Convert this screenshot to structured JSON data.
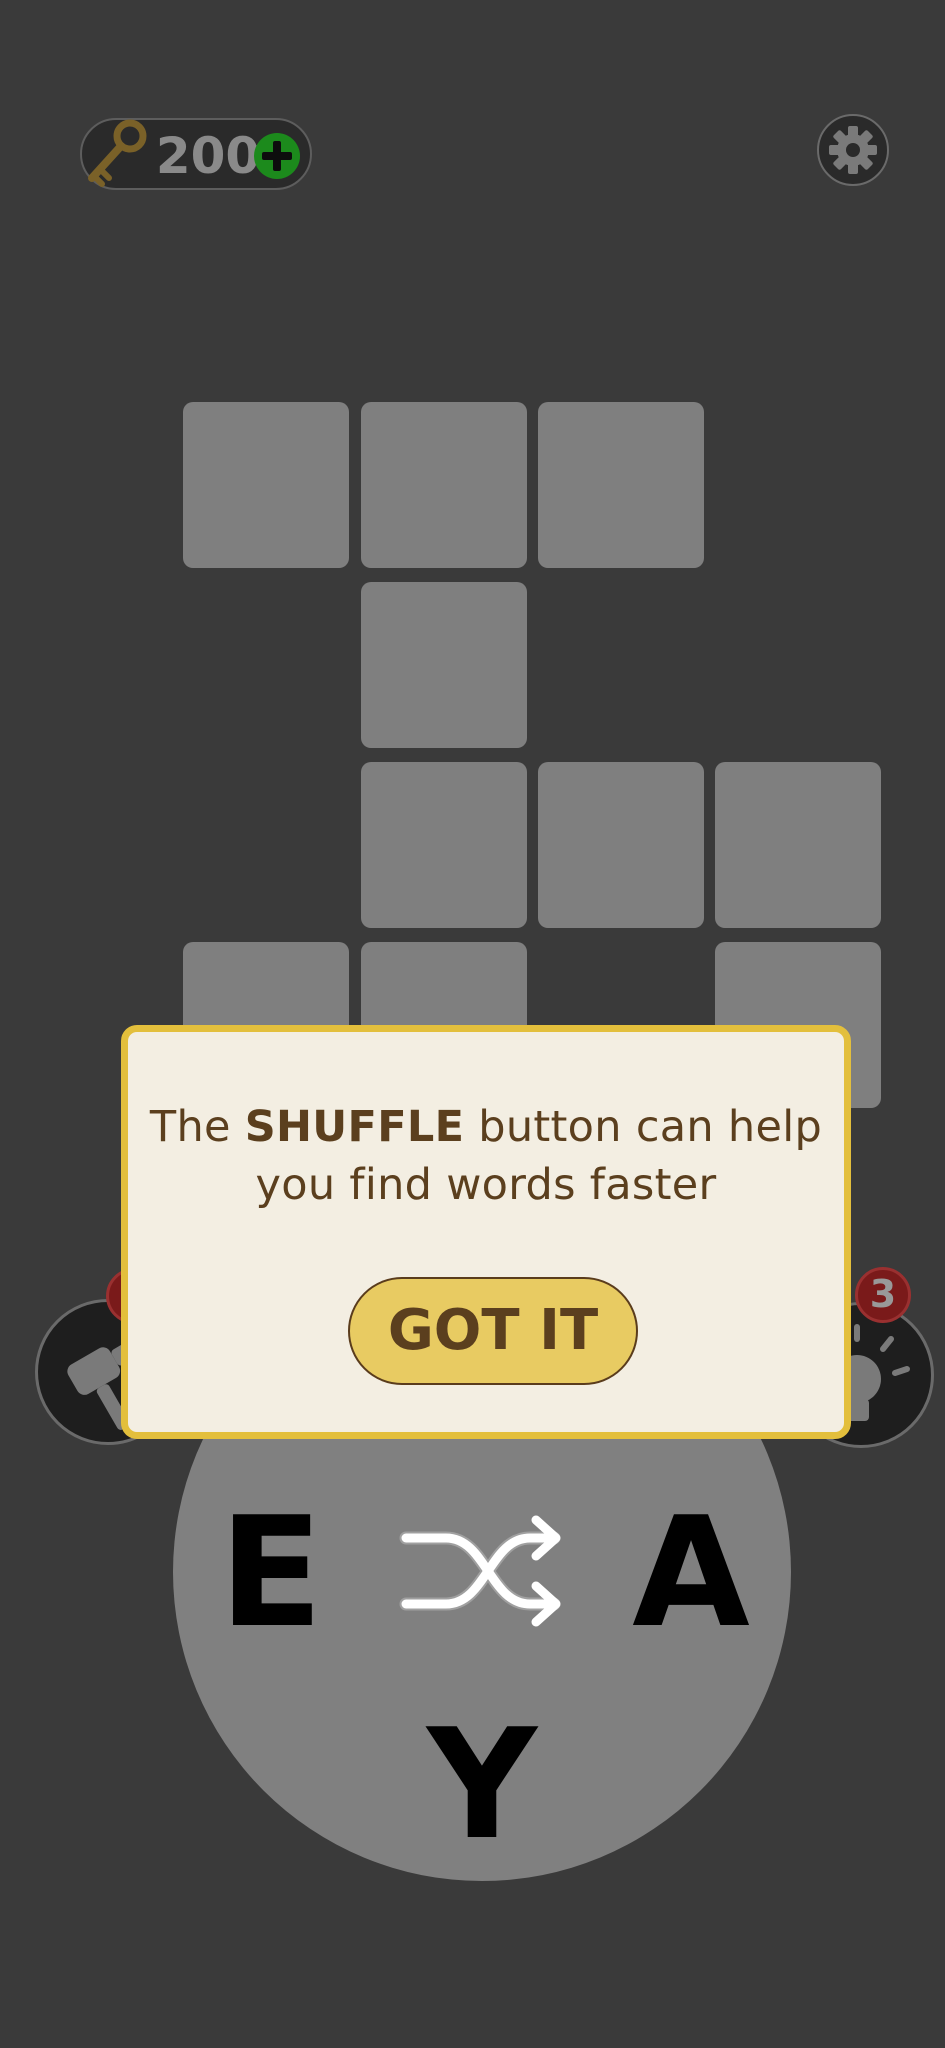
{
  "header": {
    "key_count": "200",
    "key_icon": "key-icon",
    "add_icon": "plus-icon",
    "settings_icon": "gear-icon"
  },
  "boosters": {
    "left": {
      "icon": "hammer-icon",
      "badge": ""
    },
    "right": {
      "icon": "lightbulb-icon",
      "badge": "3"
    }
  },
  "wheel": {
    "letters": [
      "E",
      "A",
      "Y"
    ],
    "center_icon": "shuffle-icon"
  },
  "dialog": {
    "message_prefix": "The ",
    "message_emphasis": "SHUFFLE",
    "message_suffix_line1": " button can help",
    "message_line2": "you find words faster",
    "button_label": "GOT IT"
  },
  "colors": {
    "background": "#3a3a3a",
    "tile": "#7f7f7f",
    "wheel": "#808080",
    "dialog_background": "#f3eee2",
    "dialog_border": "#e3bf3c",
    "button": "#e8cb62",
    "text_brown": "#5b3f1e",
    "add_green": "#1c8a1c",
    "badge_red": "#7a1a1a"
  }
}
